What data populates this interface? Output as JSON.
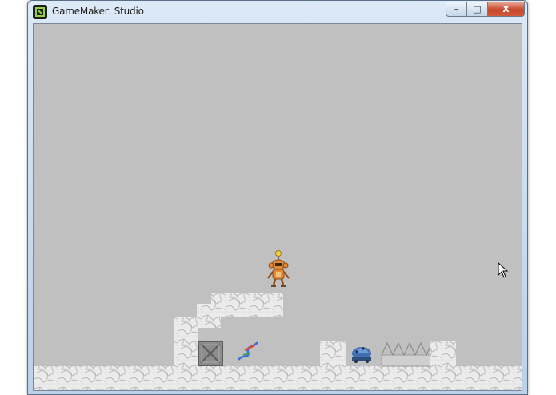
{
  "window": {
    "title": "GameMaker: Studio",
    "controls": {
      "minimize": "–",
      "maximize": "□",
      "close": "X"
    }
  },
  "game": {
    "background_color": "#c0c0c0",
    "block_color": "#ecebeb",
    "block_crack_color": "#b9b9b9",
    "player": {
      "name": "robot-monkey",
      "body_color": "#e08a3a",
      "antenna_color": "#f6d24a"
    },
    "objects": [
      "ground",
      "stone-stairs",
      "crate",
      "whip-item",
      "blue-beetle-enemy",
      "spike-trap",
      "stone-pillar"
    ]
  }
}
